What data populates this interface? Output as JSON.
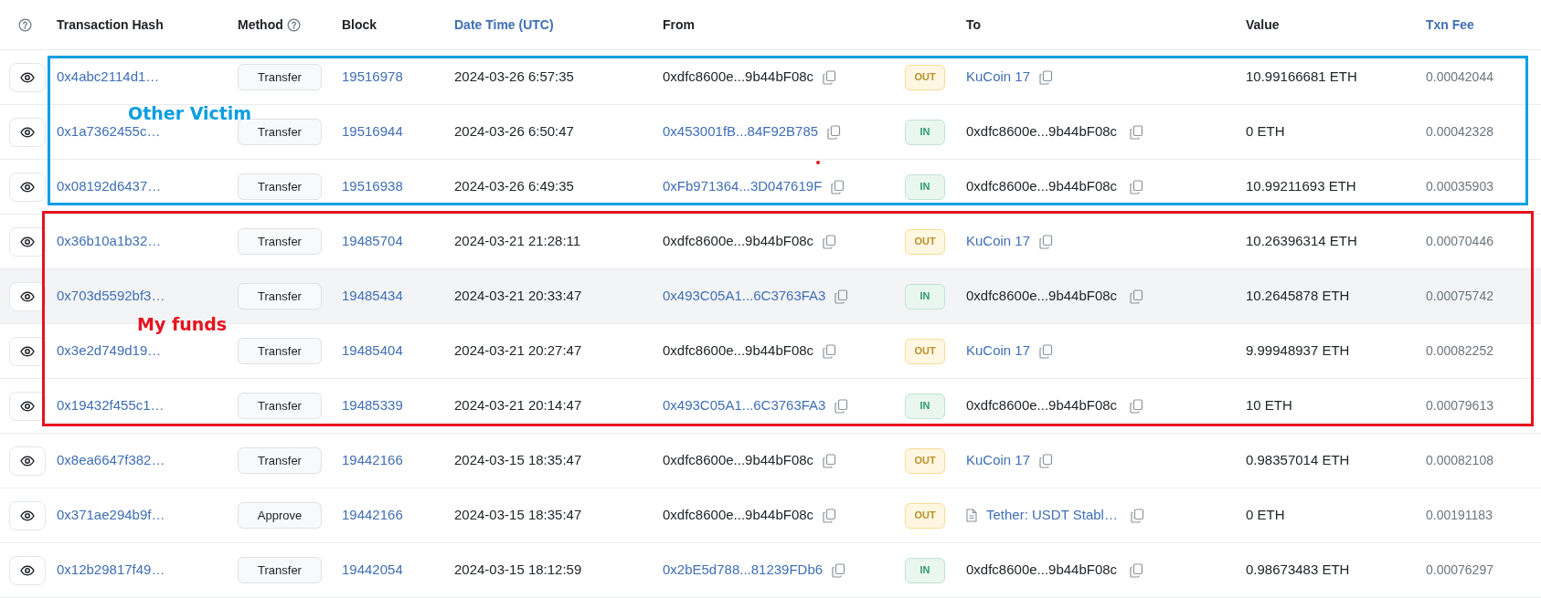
{
  "columns": [
    {
      "label": "Transaction Hash",
      "link": false,
      "help": false
    },
    {
      "label": "Method",
      "link": false,
      "help": true
    },
    {
      "label": "Block",
      "link": false,
      "help": false
    },
    {
      "label": "Date Time (UTC)",
      "link": true,
      "help": false
    },
    {
      "label": "From",
      "link": false,
      "help": false
    },
    {
      "label": "To",
      "link": false,
      "help": false
    },
    {
      "label": "Value",
      "link": false,
      "help": false
    },
    {
      "label": "Txn Fee",
      "link": true,
      "help": false
    }
  ],
  "row_groups": [
    {
      "annotation": {
        "label": "Other Victim",
        "color": "#0a9ee3"
      },
      "rows": [
        {
          "hash": "0x4abc2114d1…",
          "method": "Transfer",
          "block": "19516978",
          "datetime": "2024-03-26 6:57:35",
          "from": {
            "text": "0xdfc8600e...9b44bF08c",
            "link": false
          },
          "direction": {
            "label": "OUT",
            "kind": "out"
          },
          "to": {
            "text": "KuCoin 17",
            "link": true,
            "contract": false
          },
          "value": "10.99166681 ETH",
          "fee": "0.00042044",
          "highlighted": false
        },
        {
          "hash": "0x1a7362455c…",
          "method": "Transfer",
          "block": "19516944",
          "datetime": "2024-03-26 6:50:47",
          "from": {
            "text": "0x453001fB...84F92B785",
            "link": true
          },
          "direction": {
            "label": "IN",
            "kind": "in"
          },
          "to": {
            "text": "0xdfc8600e...9b44bF08c",
            "link": false,
            "contract": false
          },
          "value": "0 ETH",
          "fee": "0.00042328",
          "highlighted": false
        },
        {
          "hash": "0x08192d6437…",
          "method": "Transfer",
          "block": "19516938",
          "datetime": "2024-03-26 6:49:35",
          "from": {
            "text": "0xFb971364...3D047619F",
            "link": true
          },
          "direction": {
            "label": "IN",
            "kind": "in"
          },
          "to": {
            "text": "0xdfc8600e...9b44bF08c",
            "link": false,
            "contract": false
          },
          "value": "10.99211693 ETH",
          "fee": "0.00035903",
          "highlighted": false
        }
      ]
    },
    {
      "annotation": {
        "label": "My funds",
        "color": "#e5141f"
      },
      "rows": [
        {
          "hash": "0x36b10a1b32…",
          "method": "Transfer",
          "block": "19485704",
          "datetime": "2024-03-21 21:28:11",
          "from": {
            "text": "0xdfc8600e...9b44bF08c",
            "link": false
          },
          "direction": {
            "label": "OUT",
            "kind": "out"
          },
          "to": {
            "text": "KuCoin 17",
            "link": true,
            "contract": false
          },
          "value": "10.26396314 ETH",
          "fee": "0.00070446",
          "highlighted": false
        },
        {
          "hash": "0x703d5592bf3…",
          "method": "Transfer",
          "block": "19485434",
          "datetime": "2024-03-21 20:33:47",
          "from": {
            "text": "0x493C05A1...6C3763FA3",
            "link": true
          },
          "direction": {
            "label": "IN",
            "kind": "in"
          },
          "to": {
            "text": "0xdfc8600e...9b44bF08c",
            "link": false,
            "contract": false
          },
          "value": "10.2645878 ETH",
          "fee": "0.00075742",
          "highlighted": true
        },
        {
          "hash": "0x3e2d749d19…",
          "method": "Transfer",
          "block": "19485404",
          "datetime": "2024-03-21 20:27:47",
          "from": {
            "text": "0xdfc8600e...9b44bF08c",
            "link": false
          },
          "direction": {
            "label": "OUT",
            "kind": "out"
          },
          "to": {
            "text": "KuCoin 17",
            "link": true,
            "contract": false
          },
          "value": "9.99948937 ETH",
          "fee": "0.00082252",
          "highlighted": false
        },
        {
          "hash": "0x19432f455c1…",
          "method": "Transfer",
          "block": "19485339",
          "datetime": "2024-03-21 20:14:47",
          "from": {
            "text": "0x493C05A1...6C3763FA3",
            "link": true
          },
          "direction": {
            "label": "IN",
            "kind": "in"
          },
          "to": {
            "text": "0xdfc8600e...9b44bF08c",
            "link": false,
            "contract": false
          },
          "value": "10 ETH",
          "fee": "0.00079613",
          "highlighted": false
        }
      ]
    },
    {
      "rows": [
        {
          "hash": "0x8ea6647f382…",
          "method": "Transfer",
          "block": "19442166",
          "datetime": "2024-03-15 18:35:47",
          "from": {
            "text": "0xdfc8600e...9b44bF08c",
            "link": false
          },
          "direction": {
            "label": "OUT",
            "kind": "out"
          },
          "to": {
            "text": "KuCoin 17",
            "link": true,
            "contract": false
          },
          "value": "0.98357014 ETH",
          "fee": "0.00082108",
          "highlighted": false
        },
        {
          "hash": "0x371ae294b9f…",
          "method": "Approve",
          "block": "19442166",
          "datetime": "2024-03-15 18:35:47",
          "from": {
            "text": "0xdfc8600e...9b44bF08c",
            "link": false
          },
          "direction": {
            "label": "OUT",
            "kind": "out"
          },
          "to": {
            "text": "Tether: USDT Stabl…",
            "link": true,
            "contract": true
          },
          "value": "0 ETH",
          "fee": "0.00191183",
          "highlighted": false
        },
        {
          "hash": "0x12b29817f49…",
          "method": "Transfer",
          "block": "19442054",
          "datetime": "2024-03-15 18:12:59",
          "from": {
            "text": "0x2bE5d788...81239FDb6",
            "link": true
          },
          "direction": {
            "label": "IN",
            "kind": "in"
          },
          "to": {
            "text": "0xdfc8600e...9b44bF08c",
            "link": false,
            "contract": false
          },
          "value": "0.98673483 ETH",
          "fee": "0.00076297",
          "highlighted": false
        }
      ]
    }
  ]
}
